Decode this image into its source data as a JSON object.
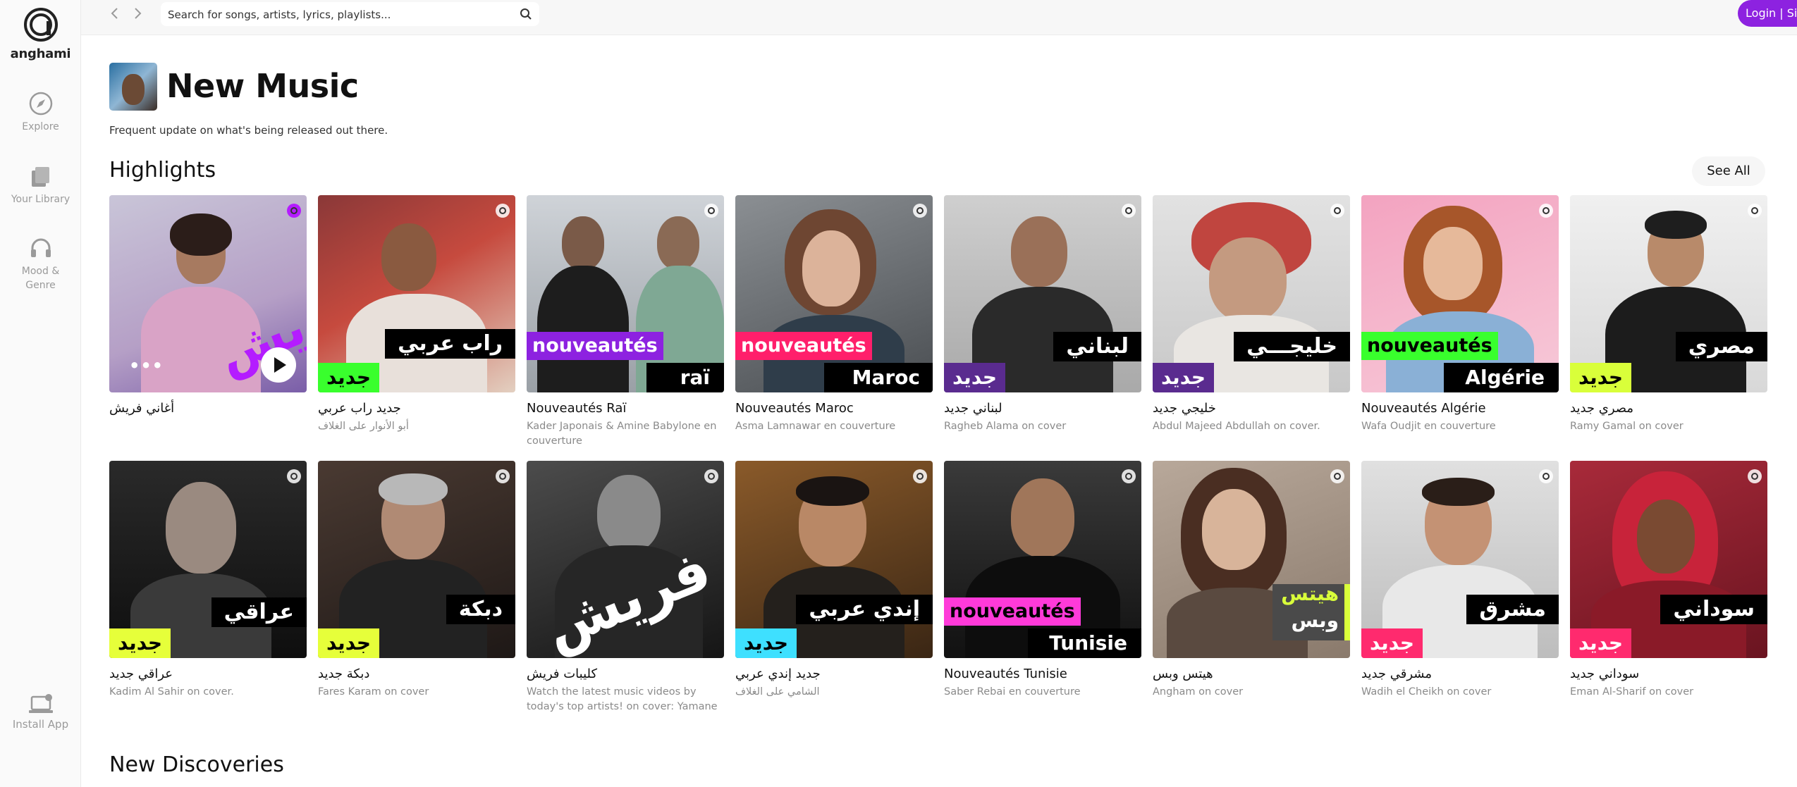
{
  "app": {
    "logo_text": "anghami"
  },
  "sidebar": {
    "items": [
      {
        "label": "Explore",
        "icon": "compass-icon"
      },
      {
        "label": "Your Library",
        "icon": "library-icon"
      },
      {
        "label_line1": "Mood &",
        "label_line2": "Genre",
        "icon": "headphones-icon"
      }
    ],
    "install": "Install App"
  },
  "topbar": {
    "search_placeholder": "Search for songs, artists, lyrics, playlists...",
    "login": "Login | Signup",
    "more": "•••"
  },
  "header": {
    "title": "New Music",
    "subtitle": "Frequent update on what's being released out there."
  },
  "highlights": {
    "title": "Highlights",
    "see_all": "See All",
    "row1": [
      {
        "title": "أغاني فريش",
        "subtitle": "",
        "art_word": "فريش"
      },
      {
        "title": "جديد راب عربي",
        "subtitle": "أبو الأنوار على الغلاف",
        "label_top": "راب عربي",
        "label_new": "جديد",
        "new_color": "#39ff2d"
      },
      {
        "title": "Nouveautés Raï",
        "subtitle": "Kader Japonais & Amine Babylone en couverture",
        "label_fr": "nouveautés",
        "label_bot": "raï",
        "fr_color": "#8d22e0"
      },
      {
        "title": "Nouveautés Maroc",
        "subtitle": "Asma Lamnawar en couverture",
        "label_fr": "nouveautés",
        "label_bot": "Maroc",
        "fr_color": "#ff1f6b"
      },
      {
        "title": "لبناني جديد",
        "subtitle": "Ragheb Alama on cover",
        "label_top": "لبناني",
        "label_new": "جديد",
        "new_color": "#5a2b8f"
      },
      {
        "title": "خليجي جديد",
        "subtitle": "Abdul Majeed Abdullah on cover.",
        "label_top": "خليجـــي",
        "label_new": "جديد",
        "new_color": "#5a2b8f"
      },
      {
        "title": "Nouveautés Algérie",
        "subtitle": "Wafa Oudjit en couverture",
        "label_fr": "nouveautés",
        "label_bot": "Algérie",
        "fr_color": "#39ff2d"
      },
      {
        "title": "مصري جديد",
        "subtitle": "Ramy Gamal on cover",
        "label_top": "مصري",
        "label_new": "جديد",
        "new_color": "#d9ff3a"
      }
    ],
    "row2": [
      {
        "title": "عراقي جديد",
        "subtitle": "Kadim Al Sahir on cover.",
        "label_top": "عراقي",
        "label_new": "جديد",
        "new_color": "#e6ff3a"
      },
      {
        "title": "دبكة جديد",
        "subtitle": "Fares Karam on cover",
        "label_top": "دبكة",
        "label_new": "جديد",
        "new_color": "#e6ff3a"
      },
      {
        "title": "كليبات فريش",
        "subtitle": "Watch the latest music videos by today's top artists! on cover: Yamane",
        "art_word": "فريش"
      },
      {
        "title": "جديد إندي عربي",
        "subtitle": "الشامي على الغلاف",
        "label_top": "إندي عربي",
        "label_new": "جديد",
        "new_color": "#3ee0ff"
      },
      {
        "title": "Nouveautés Tunisie",
        "subtitle": "Saber Rebai en couverture",
        "label_fr": "nouveautés",
        "label_bot": "Tunisie",
        "fr_color": "#ff3ad9"
      },
      {
        "title": "هيتس وبس",
        "subtitle": "Angham on cover",
        "label_hits1": "هيتس",
        "label_hits2": "وبس"
      },
      {
        "title": "مشرقي جديد",
        "subtitle": "Wadih el Cheikh on cover",
        "label_top": "مشرق",
        "label_new": "جديد",
        "new_color": "#ff2a6e"
      },
      {
        "title": "سوداني جديد",
        "subtitle": "Eman Al-Sharif on cover",
        "label_top": "سوداني",
        "label_new": "جديد",
        "new_color": "#ff2a6e"
      }
    ]
  },
  "discoveries": {
    "title": "New Discoveries"
  }
}
